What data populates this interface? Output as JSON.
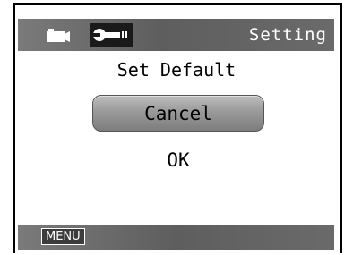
{
  "header": {
    "title": "Setting",
    "tabs": [
      {
        "icon": "video-camera-icon",
        "active": false
      },
      {
        "icon": "wrench-settings-icon",
        "active": true
      }
    ]
  },
  "dialog": {
    "heading": "Set Default",
    "options": [
      {
        "label": "Cancel",
        "selected": true
      },
      {
        "label": "OK",
        "selected": false
      }
    ]
  },
  "footer": {
    "menu_label": "MENU"
  },
  "colors": {
    "bar": "#6a6a6a",
    "selected_button": "#9a9a9a",
    "text": "#000000"
  }
}
